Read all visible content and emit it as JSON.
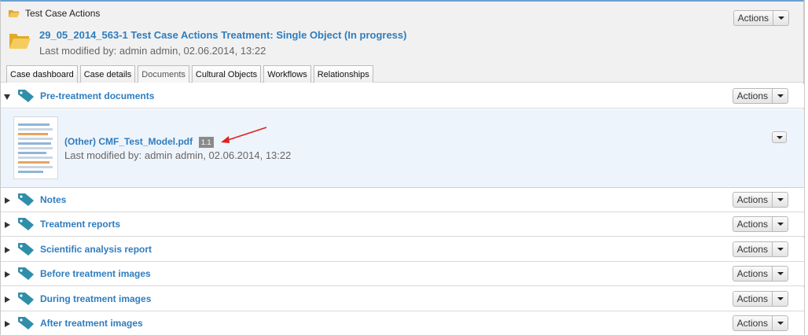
{
  "header": {
    "breadcrumb": "Test Case Actions",
    "title": "29_05_2014_563-1 Test Case Actions Treatment: Single Object (In progress)",
    "meta": "Last modified by: admin admin, 02.06.2014, 13:22",
    "actions_label": "Actions"
  },
  "tabs": [
    {
      "label": "Case dashboard",
      "active": false
    },
    {
      "label": "Case details",
      "active": false
    },
    {
      "label": "Documents",
      "active": true
    },
    {
      "label": "Cultural Objects",
      "active": false
    },
    {
      "label": "Workflows",
      "active": false
    },
    {
      "label": "Relationships",
      "active": false
    }
  ],
  "sections": [
    {
      "label": "Pre-treatment documents",
      "expanded": true,
      "actions_label": "Actions"
    },
    {
      "label": "Notes",
      "expanded": false,
      "actions_label": "Actions"
    },
    {
      "label": "Treatment reports",
      "expanded": false,
      "actions_label": "Actions"
    },
    {
      "label": "Scientific analysis report",
      "expanded": false,
      "actions_label": "Actions"
    },
    {
      "label": "Before treatment images",
      "expanded": false,
      "actions_label": "Actions"
    },
    {
      "label": "During treatment images",
      "expanded": false,
      "actions_label": "Actions"
    },
    {
      "label": "After treatment images",
      "expanded": false,
      "actions_label": "Actions"
    }
  ],
  "document": {
    "title": "(Other) CMF_Test_Model.pdf",
    "version": "1.1",
    "meta": "Last modified by: admin admin, 02.06.2014, 13:22"
  },
  "colors": {
    "link": "#2e7dbf",
    "tag_icon": "#2f8ea8",
    "arrow": "#e02020",
    "doc_panel_bg": "#eef4fb"
  }
}
